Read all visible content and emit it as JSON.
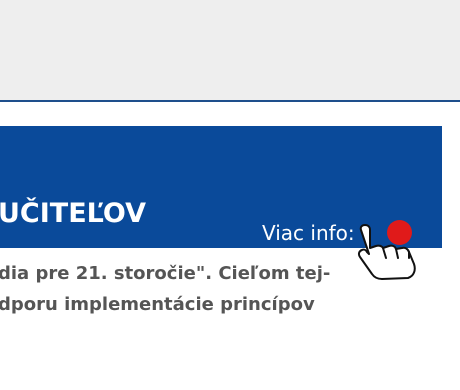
{
  "banner": {
    "title": "UČITEĽOV",
    "more_info_label": "Viac info:",
    "bg_color": "#0a4a9a",
    "accent_color": "#e01a1a"
  },
  "body": {
    "lines": [
      "dia pre 21. storočie\". Cieľom tej-",
      "dporu implementácie princípov"
    ]
  },
  "icons": {
    "pointer": "hand-pointer-icon"
  }
}
